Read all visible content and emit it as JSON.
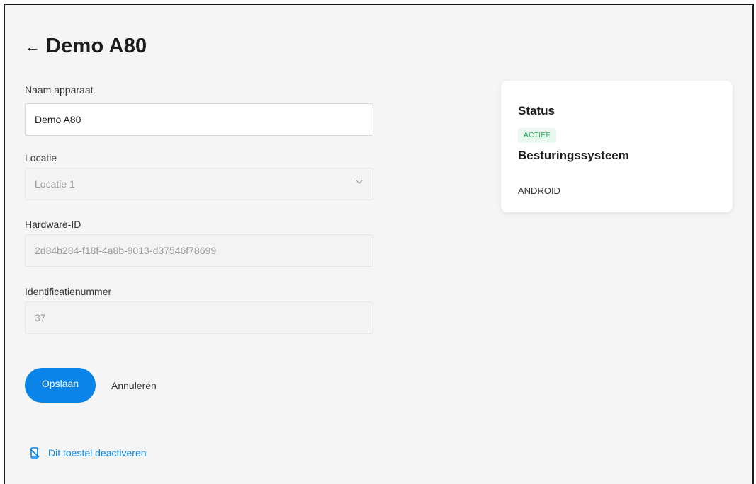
{
  "header": {
    "back_icon": "arrow-left-icon",
    "title": "Demo A80"
  },
  "form": {
    "name": {
      "label": "Naam apparaat",
      "value": "Demo A80"
    },
    "location": {
      "label": "Locatie",
      "value": "Locatie 1"
    },
    "hardware_id": {
      "label": "Hardware-ID",
      "value": "2d84b284-f18f-4a8b-9013-d37546f78699"
    },
    "id_number": {
      "label": "Identificatienummer",
      "value": "37"
    }
  },
  "actions": {
    "save": "Opslaan",
    "cancel": "Annuleren",
    "deactivate": "Dit toestel deactiveren"
  },
  "status_card": {
    "status_title": "Status",
    "status_badge": "ACTIEF",
    "os_title": "Besturingssysteem",
    "os_value": "ANDROID"
  },
  "colors": {
    "primary": "#0a84e8",
    "badge_bg": "#e8f8ef",
    "badge_text": "#1fae5b",
    "background": "#f5f5f5"
  }
}
